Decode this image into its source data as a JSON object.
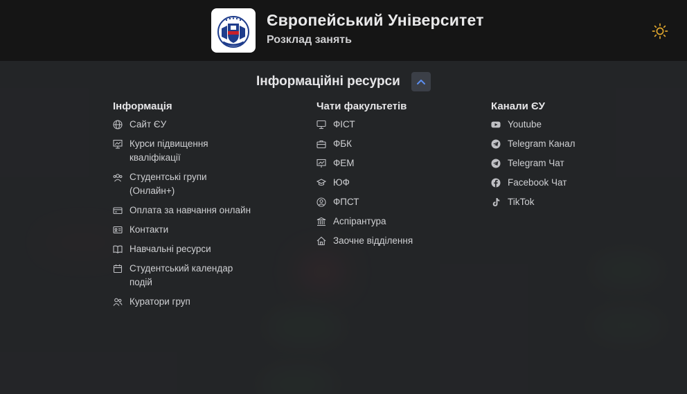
{
  "header": {
    "title": "Європейський Університет",
    "subtitle": "Розклад занять",
    "theme_toggle_icon": "sun-icon"
  },
  "resources": {
    "title": "Інформаційні ресурси",
    "toggle_icon": "chevron-up-icon"
  },
  "columns": {
    "info": {
      "title": "Інформація",
      "items": [
        {
          "label": "Сайт ЄУ",
          "icon": "globe-icon"
        },
        {
          "label": "Курси підвищення кваліфікації",
          "icon": "presentation-icon"
        },
        {
          "label": "Студентські групи (Онлайн+)",
          "icon": "users-icon"
        },
        {
          "label": "Оплата за навчання онлайн",
          "icon": "credit-card-icon"
        },
        {
          "label": "Контакти",
          "icon": "contact-card-icon"
        },
        {
          "label": "Навчальні ресурси",
          "icon": "book-icon"
        },
        {
          "label": "Студентський календар подій",
          "icon": "calendar-icon"
        },
        {
          "label": "Куратори груп",
          "icon": "user-group-icon"
        }
      ]
    },
    "faculties": {
      "title": "Чати факультетів",
      "items": [
        {
          "label": "ФІСТ",
          "icon": "monitor-icon"
        },
        {
          "label": "ФБК",
          "icon": "briefcase-icon"
        },
        {
          "label": "ФЕМ",
          "icon": "chart-board-icon"
        },
        {
          "label": "ЮФ",
          "icon": "graduation-cap-icon"
        },
        {
          "label": "ФПСТ",
          "icon": "user-circle-icon"
        },
        {
          "label": "Аспірантура",
          "icon": "institution-icon"
        },
        {
          "label": "Заочне відділення",
          "icon": "home-icon"
        }
      ]
    },
    "channels": {
      "title": "Канали ЄУ",
      "items": [
        {
          "label": "Youtube",
          "icon": "youtube-icon"
        },
        {
          "label": "Telegram Канал",
          "icon": "telegram-icon"
        },
        {
          "label": "Telegram Чат",
          "icon": "telegram-icon"
        },
        {
          "label": "Facebook Чат",
          "icon": "facebook-icon"
        },
        {
          "label": "TikTok",
          "icon": "tiktok-icon"
        }
      ]
    }
  }
}
